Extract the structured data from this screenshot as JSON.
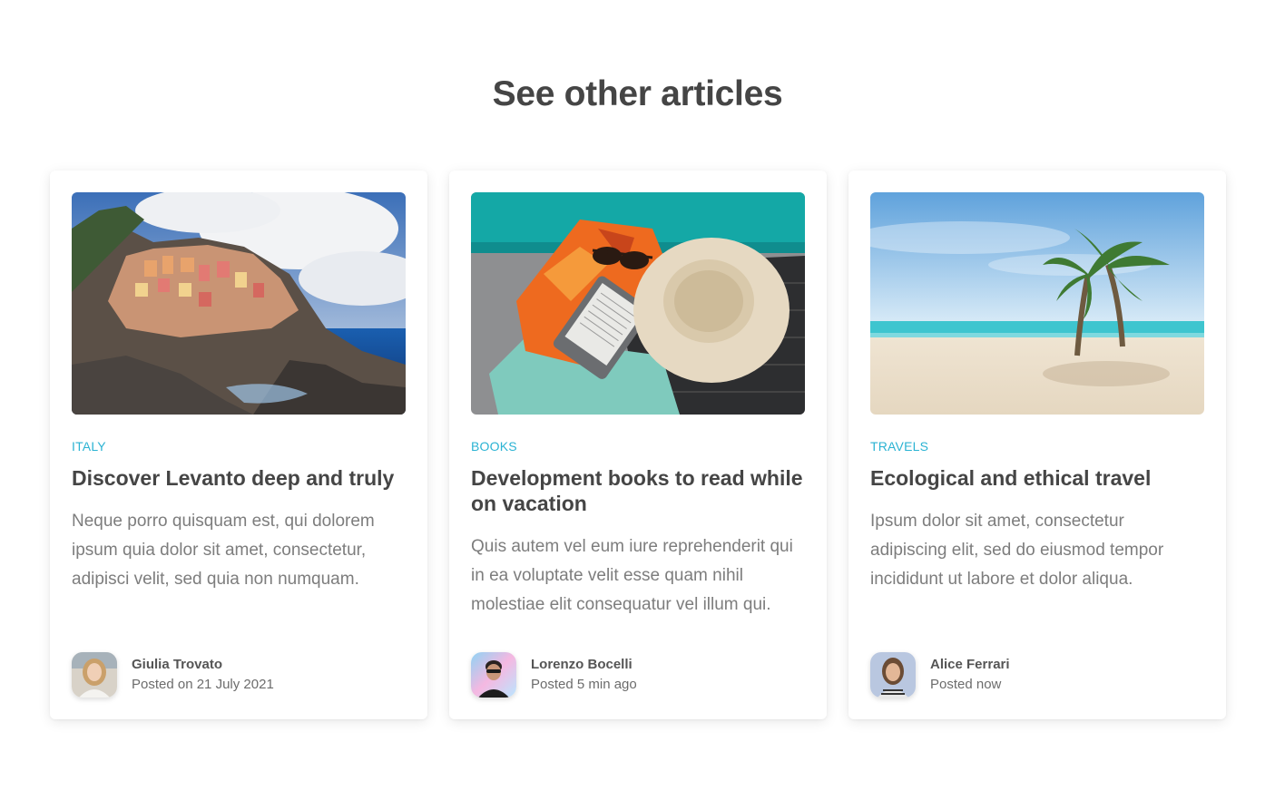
{
  "section": {
    "title": "See other articles"
  },
  "articles": [
    {
      "image_alt": "Cinque Terre cliffside village by the sea",
      "category": "ITALY",
      "title": "Discover Levanto deep and truly",
      "excerpt": "Neque porro quisquam est, qui dolorem ipsum quia dolor sit amet, consectetur, adipisci velit, sed quia non numquam.",
      "author": "Giulia Trovato",
      "posted": "Posted on 21 July 2021"
    },
    {
      "image_alt": "E-reader, straw hat, sunglasses and towel by the pool",
      "category": "BOOKS",
      "title": "Development books to read while on vacation",
      "excerpt": "Quis autem vel eum iure reprehenderit qui in ea voluptate velit esse quam nihil molestiae elit consequatur vel illum qui.",
      "author": "Lorenzo Bocelli",
      "posted": "Posted 5 min ago"
    },
    {
      "image_alt": "Palm tree on a white sand beach",
      "category": "TRAVELS",
      "title": "Ecological and ethical travel",
      "excerpt": "Ipsum dolor sit amet, consectetur adipiscing elit, sed do eiusmod tempor incididunt ut labore et dolor aliqua.",
      "author": "Alice Ferrari",
      "posted": "Posted now"
    }
  ],
  "colors": {
    "accent": "#2bb3d3",
    "heading": "#454545",
    "body_text": "#7d7d7d"
  }
}
